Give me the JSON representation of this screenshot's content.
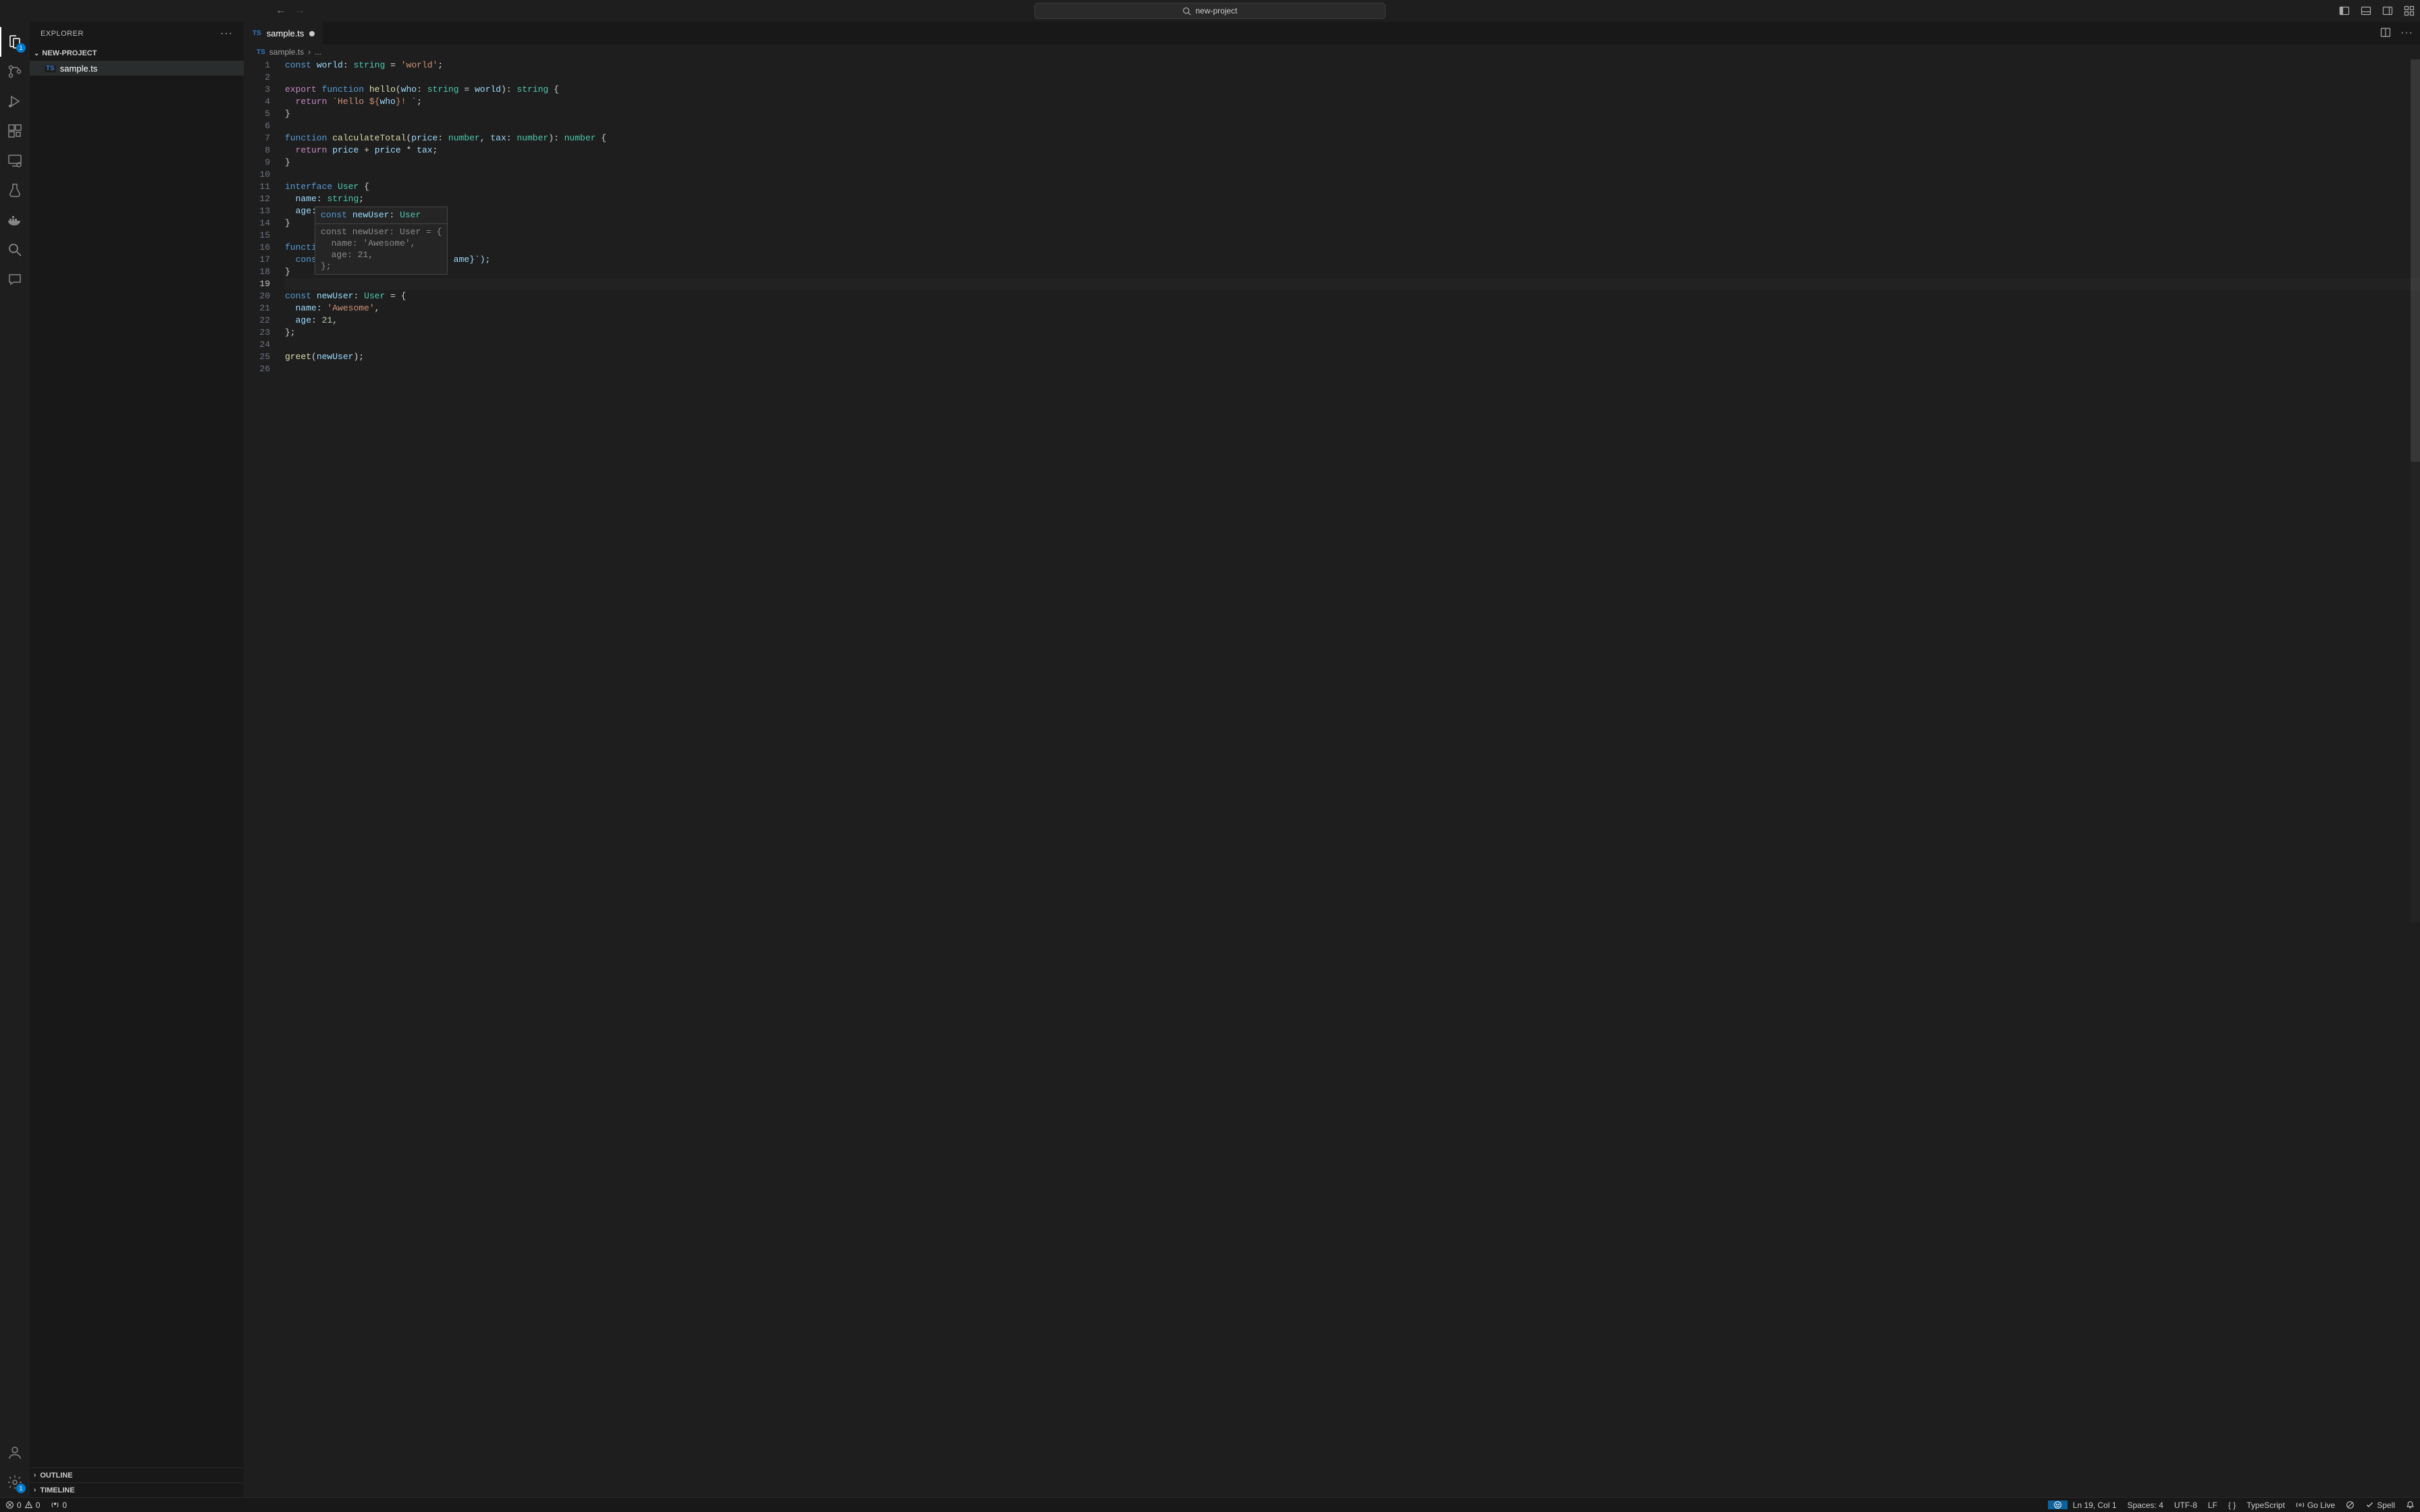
{
  "titlebar": {
    "search": "new-project"
  },
  "activitybar": {
    "explorer_badge": "1",
    "settings_badge": "1"
  },
  "sidebar": {
    "title": "EXPLORER",
    "folder": "NEW-PROJECT",
    "file": "sample.ts",
    "outline": "OUTLINE",
    "timeline": "TIMELINE"
  },
  "tab": {
    "file": "sample.ts"
  },
  "breadcrumbs": {
    "file": "sample.ts",
    "more": "..."
  },
  "gutter": {
    "count": 26,
    "current": 19
  },
  "suggest": {
    "header": "const newUser: User",
    "body": [
      "const newUser: User = {",
      "  name: 'Awesome',",
      "  age: 21,",
      "};"
    ]
  },
  "code_frag": "ame}`);",
  "statusbar": {
    "errors": "0",
    "warnings": "0",
    "ports": "0",
    "lncol": "Ln 19, Col 1",
    "spaces": "Spaces: 4",
    "encoding": "UTF-8",
    "eol": "LF",
    "brackets": "{ }",
    "lang": "TypeScript",
    "golive": "Go Live",
    "spell": "Spell"
  }
}
